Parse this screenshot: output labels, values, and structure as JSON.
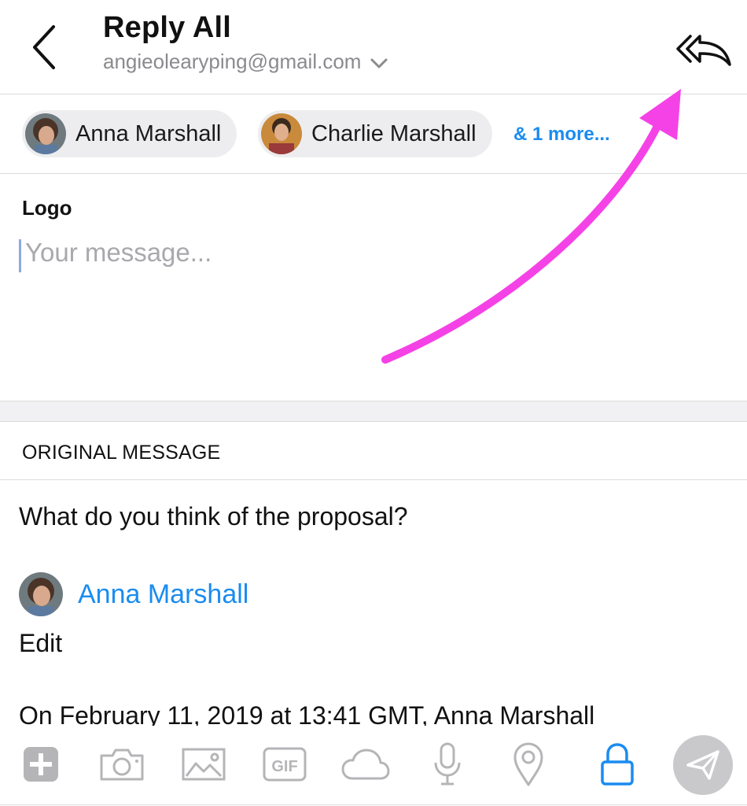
{
  "header": {
    "title": "Reply All",
    "account": "angieolearyping@gmail.com"
  },
  "recipients": {
    "chips": [
      {
        "name": "Anna Marshall"
      },
      {
        "name": "Charlie Marshall"
      }
    ],
    "more_label": "& 1 more..."
  },
  "compose": {
    "signature": "Logo",
    "placeholder": "Your message..."
  },
  "original": {
    "header": "ORIGINAL MESSAGE",
    "body": "What do you think of the proposal?",
    "sender": "Anna Marshall",
    "edit_label": "Edit",
    "quoted_line": "On February 11, 2019 at 13:41 GMT, Anna Marshall"
  },
  "toolbar": {
    "gif_label": "GIF",
    "icons": [
      "add-icon",
      "camera-icon",
      "image-icon",
      "gif-icon",
      "cloud-icon",
      "microphone-icon",
      "location-pin-icon",
      "lock-icon",
      "send-icon"
    ]
  },
  "colors": {
    "accent": "#1a8cf0",
    "annotation_arrow": "#f542e6",
    "icon_gray": "#b5b5b8",
    "send_bg": "#c9c9cc"
  }
}
